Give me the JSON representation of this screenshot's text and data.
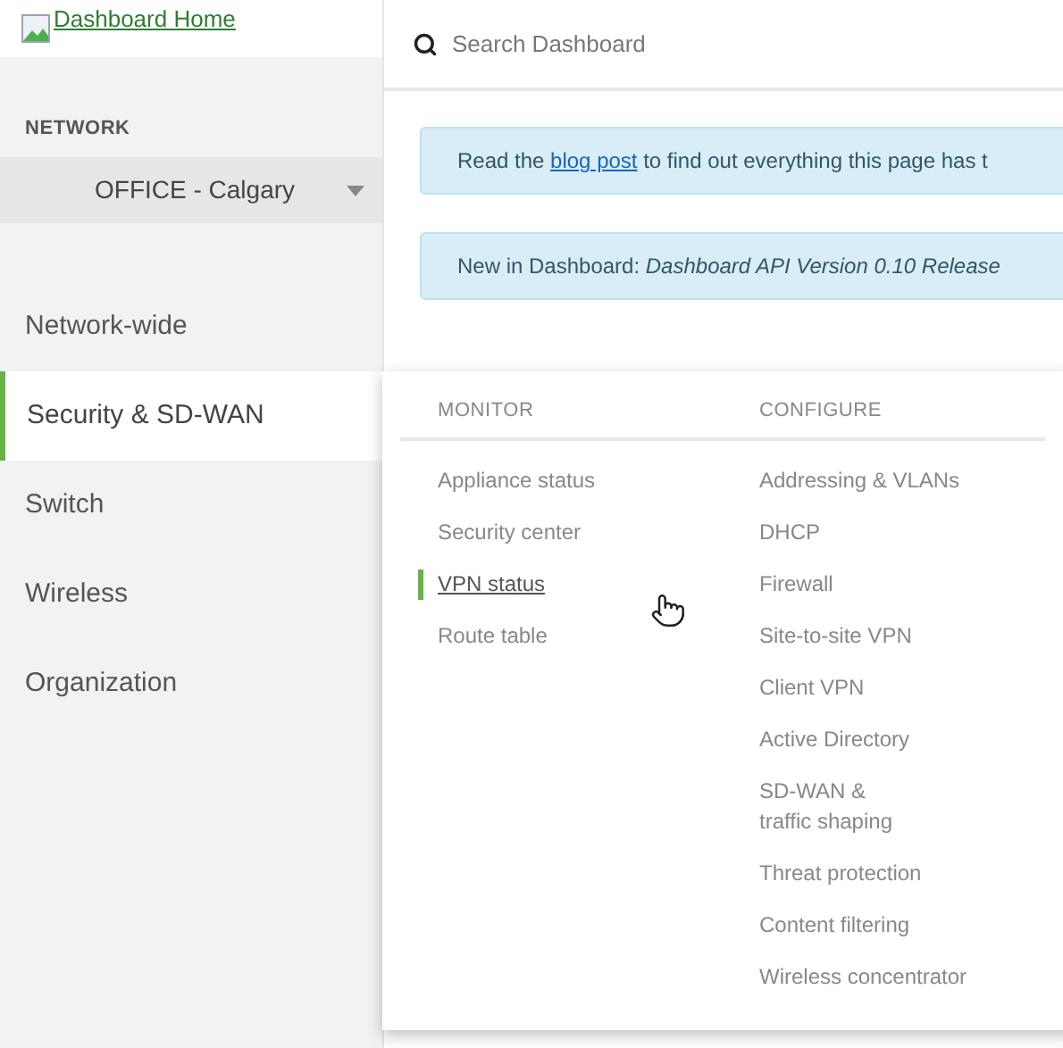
{
  "logo": {
    "alt": "Dashboard Home"
  },
  "search": {
    "placeholder": "Search Dashboard"
  },
  "network": {
    "label": "NETWORK",
    "value": "OFFICE - Calgary"
  },
  "nav": [
    {
      "label": "Network-wide",
      "selected": false
    },
    {
      "label": "Security & SD-WAN",
      "selected": true
    },
    {
      "label": "Switch",
      "selected": false
    },
    {
      "label": "Wireless",
      "selected": false
    },
    {
      "label": "Organization",
      "selected": false
    }
  ],
  "alerts": [
    {
      "prefix": "Read the ",
      "link": "blog post",
      "text": " to find out everything this page has t"
    },
    {
      "prefix": "New in Dashboard: ",
      "text": "Dashboard API Version 0.10 Release"
    }
  ],
  "flyout": {
    "columns": [
      {
        "heading": "MONITOR",
        "items": [
          {
            "label": "Appliance status",
            "selected": false
          },
          {
            "label": "Security center",
            "selected": false
          },
          {
            "label": "VPN status",
            "selected": true
          },
          {
            "label": "Route table",
            "selected": false
          }
        ]
      },
      {
        "heading": "CONFIGURE",
        "items": [
          {
            "label": "Addressing & VLANs",
            "selected": false
          },
          {
            "label": "DHCP",
            "selected": false
          },
          {
            "label": "Firewall",
            "selected": false
          },
          {
            "label": "Site-to-site VPN",
            "selected": false
          },
          {
            "label": "Client VPN",
            "selected": false
          },
          {
            "label": "Active Directory",
            "selected": false
          },
          {
            "label": "SD-WAN &\ntraffic shaping",
            "selected": false
          },
          {
            "label": "Threat protection",
            "selected": false
          },
          {
            "label": "Content filtering",
            "selected": false
          },
          {
            "label": "Wireless concentrator",
            "selected": false
          }
        ]
      }
    ]
  }
}
